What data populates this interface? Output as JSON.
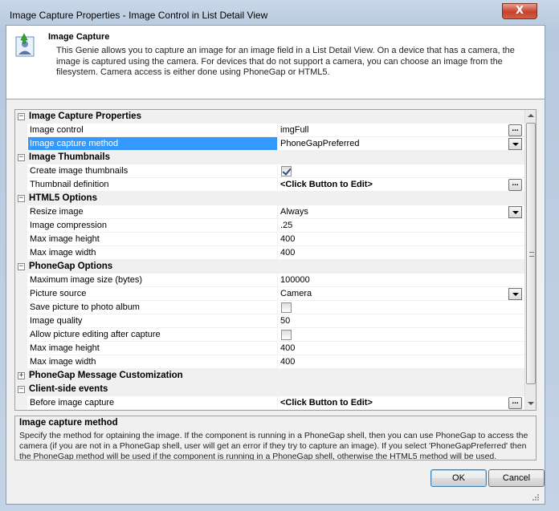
{
  "window": {
    "title": "Image Capture Properties - Image Control in List Detail View",
    "close_glyph": "X"
  },
  "header": {
    "icon": "image-capture-icon",
    "title": "Image Capture",
    "description": "This Genie allows you to capture an image for an image field in a List Detail View. On a device that has a camera, the image is captured using the camera. For devices that do not support a camera, you can choose an image from the filesystem. Camera access is either done using PhoneGap or HTML5."
  },
  "grid": {
    "categories": {
      "image_capture_properties": "Image Capture Properties",
      "image_thumbnails": "Image Thumbnails",
      "html5_options": "HTML5 Options",
      "phonegap_options": "PhoneGap Options",
      "phonegap_message_customization": "PhoneGap Message Customization",
      "client_side_events": "Client-side events"
    },
    "collapse_glyph": "−",
    "expand_glyph": "+",
    "ellipsis": "...",
    "rows": {
      "image_control": {
        "name": "Image control",
        "value": "imgFull"
      },
      "image_capture_method": {
        "name": "Image capture method",
        "value": "PhoneGapPreferred"
      },
      "create_image_thumbnails": {
        "name": "Create image thumbnails",
        "checked": true
      },
      "thumbnail_definition": {
        "name": "Thumbnail definition",
        "value": "<Click Button to Edit>"
      },
      "resize_image": {
        "name": "Resize image",
        "value": "Always"
      },
      "image_compression": {
        "name": "Image compression",
        "value": ".25"
      },
      "html5_max_image_height": {
        "name": "Max image height",
        "value": "400"
      },
      "html5_max_image_width": {
        "name": "Max image width",
        "value": "400"
      },
      "maximum_image_size": {
        "name": "Maximum image size (bytes)",
        "value": "100000"
      },
      "picture_source": {
        "name": "Picture source",
        "value": "Camera"
      },
      "save_picture_to_album": {
        "name": "Save picture to photo album",
        "checked": false
      },
      "image_quality": {
        "name": "Image quality",
        "value": "50"
      },
      "allow_picture_editing": {
        "name": "Allow picture editing after capture",
        "checked": false
      },
      "pg_max_image_height": {
        "name": "Max image height",
        "value": "400"
      },
      "pg_max_image_width": {
        "name": "Max image width",
        "value": "400"
      },
      "before_image_capture": {
        "name": "Before image capture",
        "value": "<Click Button to Edit>"
      }
    }
  },
  "description_panel": {
    "title": "Image capture method",
    "text": "Specify the method for optaining the image. If the component is running in a PhoneGap shell, then you can use PhoneGap to access the camera (if you are not in a PhoneGap shell, user will get an error if they try to capture an image). If you select 'PhoneGapPreferred' then the PhoneGap method will be used if the component is running in a PhoneGap shell, otherwise the HTML5 method will be used."
  },
  "buttons": {
    "ok": "OK",
    "cancel": "Cancel"
  },
  "colors": {
    "selection": "#3399ff",
    "close_button": "#c7402a"
  }
}
